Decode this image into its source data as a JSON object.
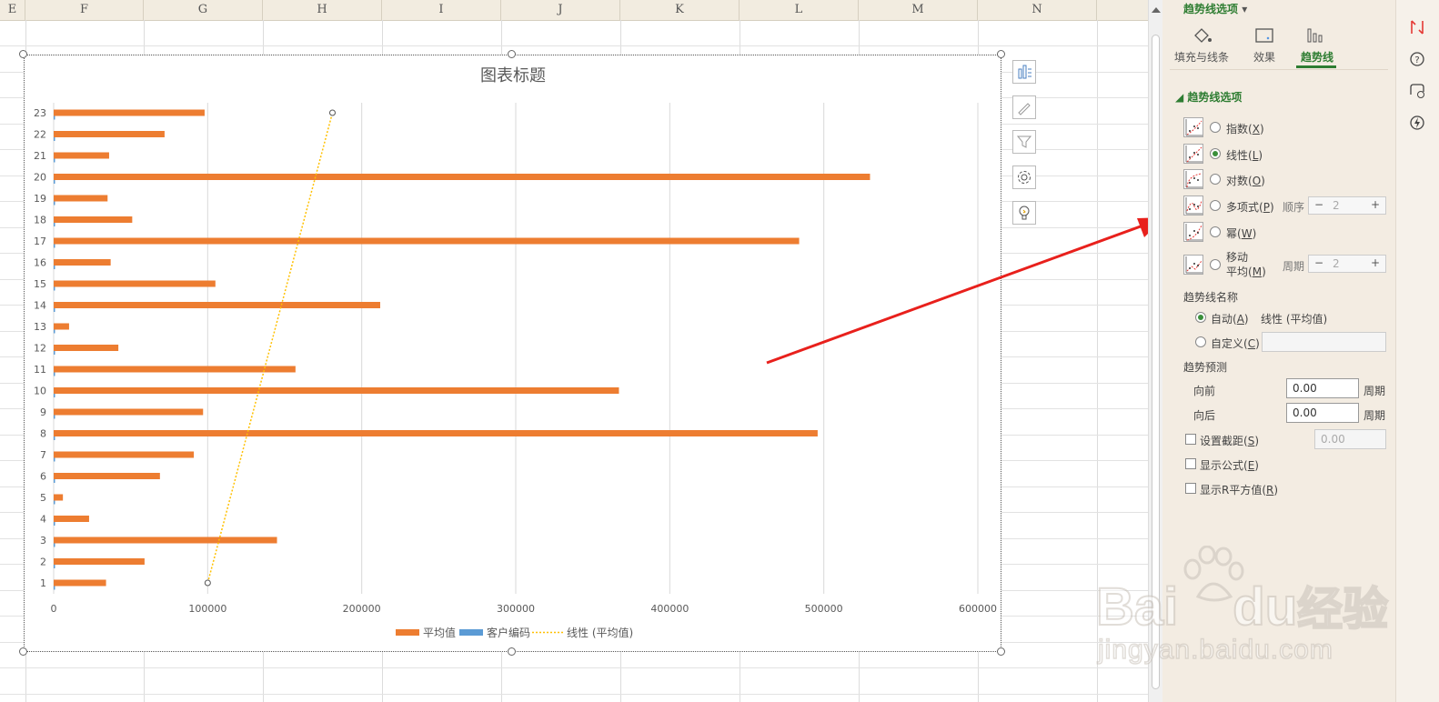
{
  "sheet": {
    "columns": [
      "E",
      "F",
      "G",
      "H",
      "I",
      "J",
      "K",
      "L",
      "M",
      "N"
    ]
  },
  "chart_data": {
    "type": "bar",
    "title": "图表标题",
    "orientation": "horizontal",
    "categories": [
      "1",
      "2",
      "3",
      "4",
      "5",
      "6",
      "7",
      "8",
      "9",
      "10",
      "11",
      "12",
      "13",
      "14",
      "15",
      "16",
      "17",
      "18",
      "19",
      "20",
      "21",
      "22",
      "23"
    ],
    "series": [
      {
        "name": "平均值",
        "color": "#ed7d31",
        "values": [
          34000,
          59000,
          145000,
          23000,
          6000,
          69000,
          91000,
          496000,
          97000,
          367000,
          157000,
          42000,
          10000,
          212000,
          105000,
          37000,
          484000,
          51000,
          35000,
          530000,
          36000,
          72000,
          98000
        ]
      },
      {
        "name": "客户编码",
        "color": "#5b9bd5",
        "values": [
          1,
          2,
          3,
          4,
          5,
          6,
          7,
          8,
          9,
          10,
          11,
          12,
          13,
          14,
          15,
          16,
          17,
          18,
          19,
          20,
          21,
          22,
          23
        ]
      }
    ],
    "trendline": {
      "name": "线性 (平均值)",
      "type": "linear",
      "color": "#ffc000",
      "start": {
        "x": 100000,
        "y": 1
      },
      "end": {
        "x": 181000,
        "y": 23
      }
    },
    "xticks": [
      "0",
      "100000",
      "200000",
      "300000",
      "400000",
      "500000",
      "600000"
    ],
    "xlim": [
      0,
      600000
    ],
    "grid": true,
    "legend": "bottom"
  },
  "pane": {
    "header": "趋势线选项",
    "tabs": [
      {
        "label": "填充与线条",
        "icon": "fill-bucket-icon"
      },
      {
        "label": "效果",
        "icon": "effects-icon"
      },
      {
        "label": "趋势线",
        "icon": "trendline-bars-icon"
      }
    ],
    "section": "趋势线选项",
    "types": [
      {
        "label": "指数",
        "key": "X",
        "selected": false
      },
      {
        "label": "线性",
        "key": "L",
        "selected": true
      },
      {
        "label": "对数",
        "key": "O",
        "selected": false
      },
      {
        "label": "多项式",
        "key": "P",
        "selected": false
      },
      {
        "label": "幂",
        "key": "W",
        "selected": false
      },
      {
        "label": "移动平均",
        "key": "M",
        "selected": false
      }
    ],
    "order_label": "顺序",
    "order_value": "2",
    "period_label": "周期",
    "period_value": "2",
    "name_header": "趋势线名称",
    "auto_label": "自动",
    "auto_key": "A",
    "auto_value": "线性 (平均值)",
    "custom_label": "自定义",
    "custom_key": "C",
    "forecast_header": "趋势预测",
    "forward_label": "向前",
    "forward_value": "0.00",
    "backward_label": "向后",
    "backward_value": "0.00",
    "unit_label": "周期",
    "intercept_label": "设置截距",
    "intercept_key": "S",
    "intercept_value": "0.00",
    "show_eq_label": "显示公式",
    "show_eq_key": "E",
    "show_r2_label": "显示R平方值",
    "show_r2_key": "R",
    "minus": "−",
    "plus": "+"
  },
  "watermark": {
    "text1": "Bai",
    "text2": "du",
    "text3": "经验",
    "url": "jingyan.baidu.com"
  }
}
